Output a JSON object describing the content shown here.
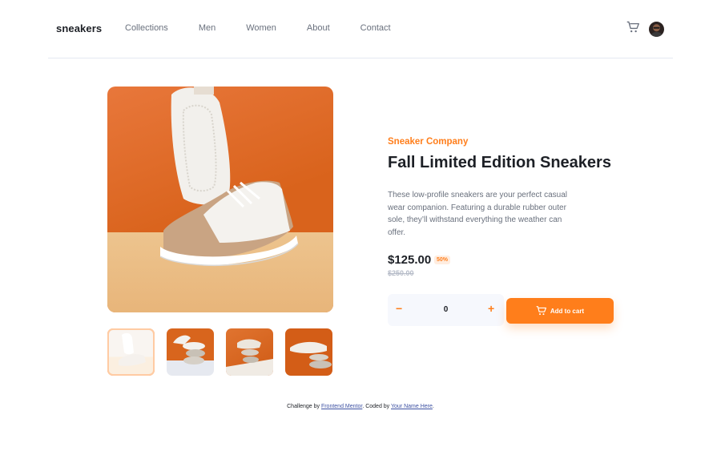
{
  "header": {
    "logo": "sneakers",
    "nav": [
      "Collections",
      "Men",
      "Women",
      "About",
      "Contact"
    ],
    "cart_icon": "cart-icon",
    "avatar": "avatar"
  },
  "product": {
    "company": "Sneaker Company",
    "title": "Fall Limited Edition Sneakers",
    "description": "These low-profile sneakers are your perfect casual wear companion. Featuring a durable rubber outer sole, they’ll withstand everything the weather can offer.",
    "price": "$125.00",
    "discount": "50%",
    "old_price": "$250.00"
  },
  "cart": {
    "minus": "−",
    "quantity": "0",
    "plus": "+",
    "add_label": "Add to cart"
  },
  "footer": {
    "prefix": "Challenge by",
    "challenge_link": "Frontend Mentor",
    "middle": ". Coded by",
    "author_link": "Your Name Here",
    "suffix": "."
  },
  "colors": {
    "accent": "#ff7e1b",
    "dark": "#1d2026",
    "muted": "#69707d"
  }
}
